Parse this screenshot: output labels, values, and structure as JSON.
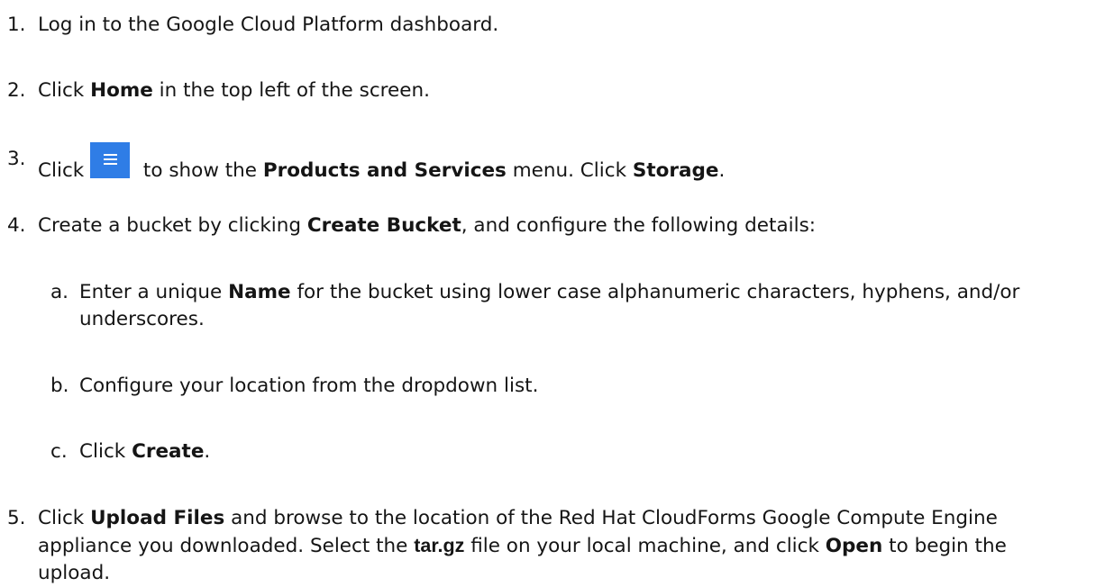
{
  "steps": [
    {
      "num": "1.",
      "parts": [
        "Log in to the Google Cloud Platform dashboard."
      ]
    },
    {
      "num": "2.",
      "pre": "Click ",
      "b1": "Home",
      "post": " in the top left of the screen."
    },
    {
      "num": "3.",
      "pre": "Click ",
      "mid": " to show the ",
      "b1": "Products and Services",
      "mid2": " menu. Click ",
      "b2": "Storage",
      "post": "."
    },
    {
      "num": "4.",
      "pre": "Create a bucket by clicking ",
      "b1": "Create Bucket",
      "post": ", and configure the following details:"
    },
    {
      "num": "5.",
      "pre": "Click ",
      "b1": "Upload Files",
      "mid": " and browse to the location of the Red Hat CloudForms Google Compute Engine appliance you downloaded. Select the ",
      "b2": "tar.gz",
      "mid2": " file on your local machine, and click ",
      "b3": "Open",
      "post": " to begin the upload."
    }
  ],
  "substeps": [
    {
      "num": "a.",
      "pre": "Enter a unique ",
      "b1": "Name",
      "post": " for the bucket using lower case alphanumeric characters, hyphens, and/or underscores."
    },
    {
      "num": "b.",
      "pre": "Configure your location from the dropdown list."
    },
    {
      "num": "c.",
      "pre": "Click ",
      "b1": "Create",
      "post": "."
    }
  ],
  "colors": {
    "menu_button": "#2f7de6",
    "text": "#151515"
  },
  "icons": {
    "menu_button": "hamburger-menu-icon"
  }
}
